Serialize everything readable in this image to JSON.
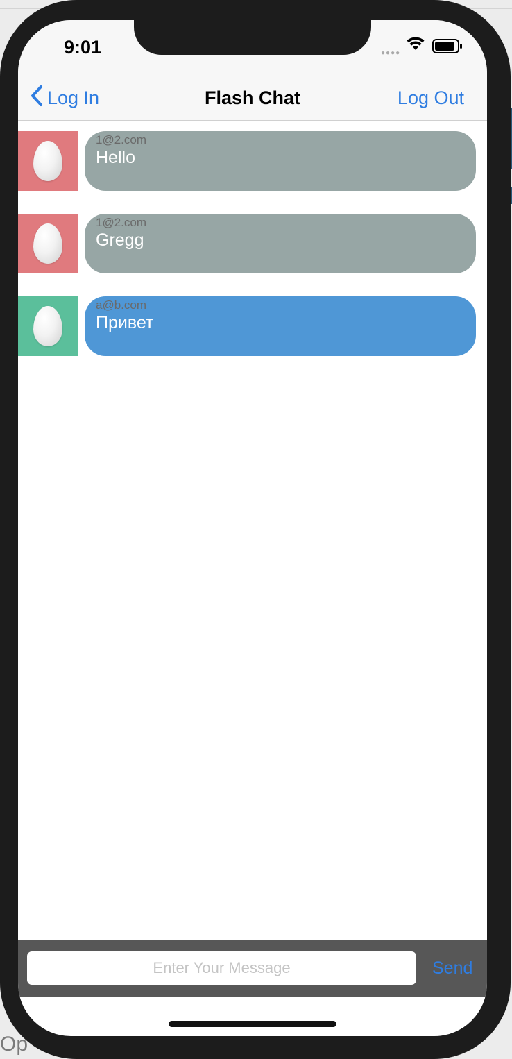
{
  "status_bar": {
    "time": "9:01"
  },
  "nav": {
    "back_label": "Log In",
    "title": "Flash Chat",
    "logout_label": "Log Out"
  },
  "messages": [
    {
      "sender": "1@2.com",
      "text": "Hello",
      "avatar_color": "#e07a7e",
      "bubble_color": "#97a6a5"
    },
    {
      "sender": "1@2.com",
      "text": "Gregg",
      "avatar_color": "#e07a7e",
      "bubble_color": "#97a6a5"
    },
    {
      "sender": "a@b.com",
      "text": "Привет",
      "avatar_color": "#5bbf9b",
      "bubble_color": "#4f97d6"
    }
  ],
  "composer": {
    "placeholder": "Enter Your Message",
    "send_label": "Send"
  },
  "background_caption": "Op",
  "colors": {
    "accent": "#2f7de1",
    "input_bar": "#575757"
  }
}
